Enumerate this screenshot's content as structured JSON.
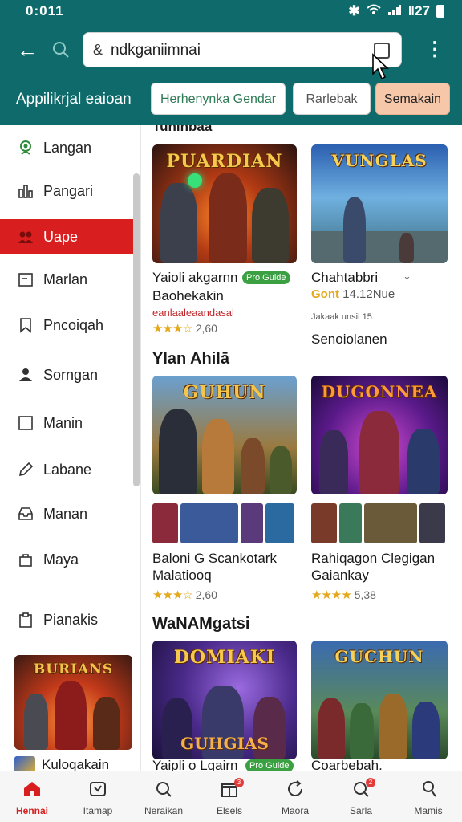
{
  "status_bar": {
    "time": "0:011",
    "signal_text": "ǁ27"
  },
  "search": {
    "value": "ndkganiimnai"
  },
  "app": {
    "title": "Appilikrjal eaioan"
  },
  "chips": [
    "Herhenynka Gendar",
    "Rarlebak",
    "Semakain"
  ],
  "sidebar": {
    "items": [
      {
        "label": "Langan",
        "icon": "person-pin-icon"
      },
      {
        "label": "Pangari",
        "icon": "bar-chart-icon"
      },
      {
        "label": "Uape",
        "icon": "group-icon",
        "active": true
      },
      {
        "label": "Marlan",
        "icon": "calendar-icon"
      },
      {
        "label": "Pncoiqah",
        "icon": "bookmark-icon"
      },
      {
        "label": "Sorngan",
        "icon": "user-icon"
      },
      {
        "label": "Manin",
        "icon": "square-icon"
      },
      {
        "label": "Labane",
        "icon": "pencil-icon"
      },
      {
        "label": "Manan",
        "icon": "inbox-icon"
      },
      {
        "label": "Maya",
        "icon": "bag-icon"
      },
      {
        "label": "Pianakis",
        "icon": "clipboard-icon"
      }
    ],
    "banner_title": "BURIANS",
    "banner_caption": "Kuloqakain"
  },
  "main": {
    "top_section_title": "Tuninbaa",
    "cards_row1": [
      {
        "art_title": "PUARDIAN",
        "name": "Yaioli akgarnn",
        "badge": "Pro Guide",
        "name2": "Baohekakin",
        "subtitle": "eanlaaleaandasal",
        "rating": "2,60"
      },
      {
        "art_title": "VUNGLAS",
        "name": "Chahtabbri",
        "price_label": "Gont",
        "price": "14.12Nue",
        "small": "Jakaak unsil 15",
        "name2": "Senoiolanen"
      }
    ],
    "section2_title": "Ylan Ahilā",
    "cards_row2": [
      {
        "art_title": "GUHUN",
        "name": "Baloni G Scankotark",
        "name2": "Malatiooq",
        "rating": "2,60"
      },
      {
        "art_title": "DUGONNEA",
        "name": "Rahiqagon Clegigan",
        "name2": "Gaiankay",
        "rating": "5,38"
      }
    ],
    "section3_title": "WaNAMgatsi",
    "cards_row3": [
      {
        "art_title": "DOMIAKI",
        "art_sub": "GUHGIAS",
        "name": "Yaipli o Lgairn",
        "badge": "Pro Guide"
      },
      {
        "art_title": "GUCHUN",
        "name": "Coarbebah."
      }
    ]
  },
  "bottom_nav": [
    {
      "label": "Hennai",
      "icon": "home-icon",
      "active": true
    },
    {
      "label": "Itamap",
      "icon": "inbox-icon"
    },
    {
      "label": "Neraikan",
      "icon": "search-icon"
    },
    {
      "label": "Elsels",
      "icon": "gift-icon",
      "badge": "3"
    },
    {
      "label": "Maora",
      "icon": "refresh-icon"
    },
    {
      "label": "Sarla",
      "icon": "search-icon",
      "badge": "2"
    },
    {
      "label": "Mamis",
      "icon": "user-icon"
    }
  ],
  "colors": {
    "app_bar": "#0f6b6b",
    "accent_red": "#d81e1e",
    "star": "#e3a81b"
  }
}
